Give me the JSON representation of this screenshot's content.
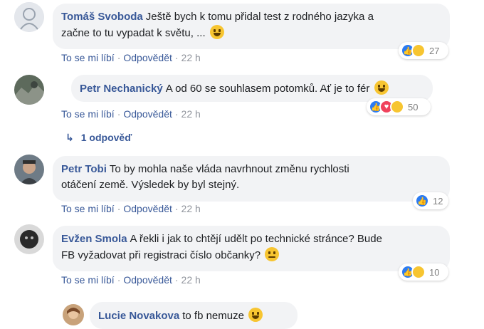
{
  "comments": [
    {
      "author": "Tomáš Svoboda",
      "text_line1": "Ještě bych k tomu přidal test z rodného jazyka a",
      "text_line2": "začne to tu vypadat k světu, ...",
      "like_label": "To se mi líbí",
      "reply_label": "Odpovědět",
      "time": "22 h",
      "reaction_count": "27",
      "reactions": [
        "like",
        "haha"
      ]
    },
    {
      "author": "Petr Nechanický",
      "text_line1": "A od 60 se souhlasem potomků. Ať je to fér",
      "like_label": "To se mi líbí",
      "reply_label": "Odpovědět",
      "time": "22 h",
      "reaction_count": "50",
      "reactions": [
        "like",
        "love",
        "haha"
      ],
      "replies_label": "1 odpověď"
    },
    {
      "author": "Petr Tobi",
      "text_line1": "To by mohla naše vláda navrhnout změnu rychlosti",
      "text_line2": "otáčení země. Výsledek by byl stejný.",
      "like_label": "To se mi líbí",
      "reply_label": "Odpovědět",
      "time": "22 h",
      "reaction_count": "12",
      "reactions": [
        "like"
      ]
    },
    {
      "author": "Evžen Smola",
      "text_line1": "A řekli i jak to chtějí udělt po technické stránce? Bude",
      "text_line2": "FB vyžadovat při registraci číslo občanky?",
      "like_label": "To se mi líbí",
      "reply_label": "Odpovědět",
      "time": "22 h",
      "reaction_count": "10",
      "reactions": [
        "like",
        "haha"
      ]
    },
    {
      "author": "Lucie Novakova",
      "text_line1": "to fb nemuze"
    }
  ],
  "colors": {
    "link": "#385898",
    "bubble": "#f2f3f5",
    "like": "#2b7bf2",
    "love": "#f0425c",
    "haha": "#f7c531"
  }
}
